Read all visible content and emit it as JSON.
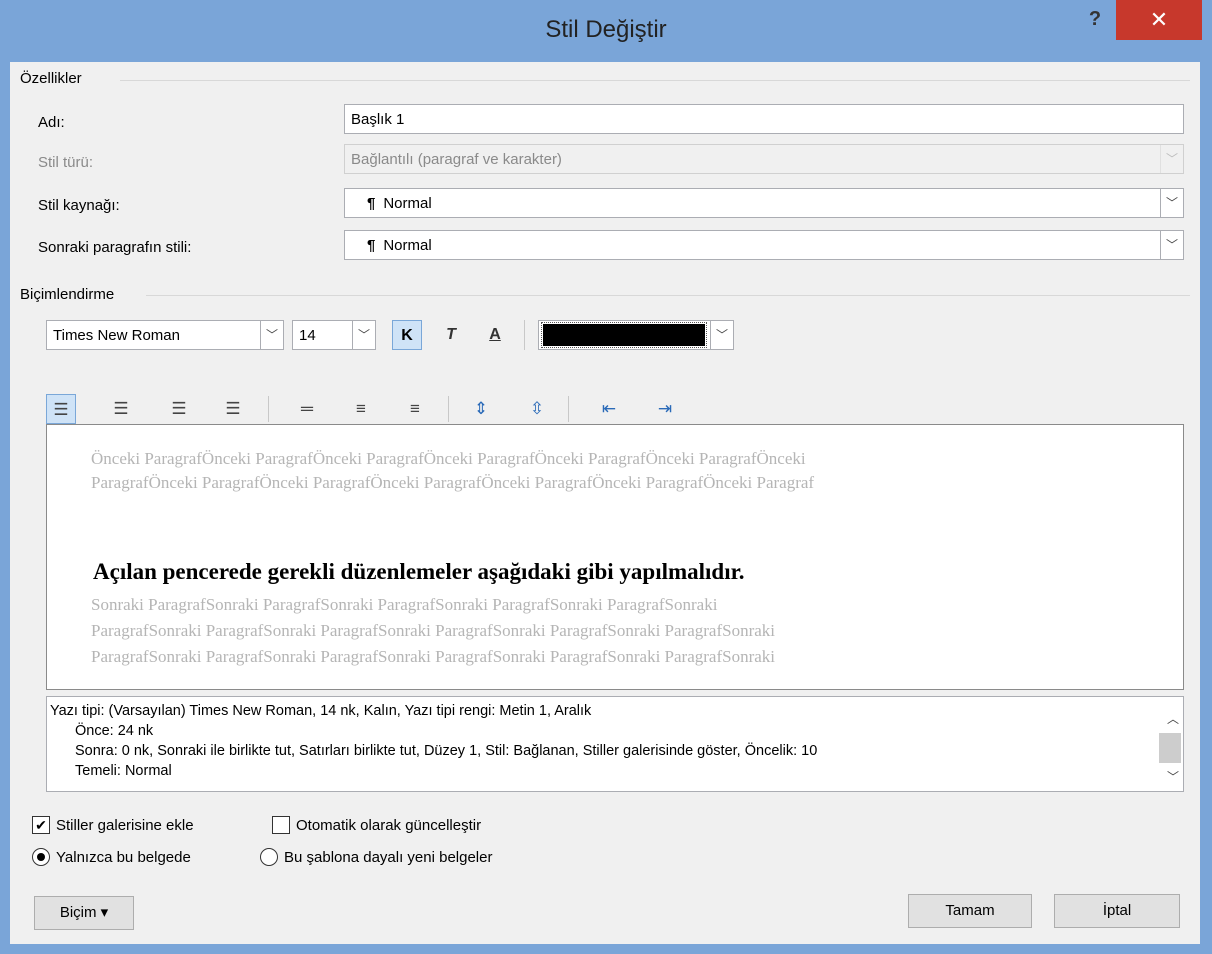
{
  "window": {
    "title": "Stil Değiştir",
    "help": "?",
    "close": "✕"
  },
  "properties": {
    "group_label": "Özellikler",
    "name": {
      "label": "Adı:",
      "value": "Başlık 1"
    },
    "style_type": {
      "label": "Stil türü:",
      "value": "Bağlantılı (paragraf ve karakter)"
    },
    "style_base": {
      "label": "Stil kaynağı:",
      "value": "Normal"
    },
    "next_style": {
      "label": "Sonraki paragrafın stili:",
      "value": "Normal"
    }
  },
  "formatting": {
    "group_label": "Biçimlendirme",
    "font": "Times New Roman",
    "size": "14",
    "bold": "K",
    "italic": "T",
    "underline": "A",
    "font_color": "#000000"
  },
  "preview": {
    "previous_line1": "Önceki ParagrafÖnceki ParagrafÖnceki ParagrafÖnceki ParagrafÖnceki ParagrafÖnceki ParagrafÖnceki",
    "previous_line2": "ParagrafÖnceki ParagrafÖnceki ParagrafÖnceki ParagrafÖnceki ParagrafÖnceki ParagrafÖnceki Paragraf",
    "heading": "Açılan pencerede gerekli düzenlemeler aşağıdaki gibi yapılmalıdır.",
    "next_line1": "Sonraki ParagrafSonraki ParagrafSonraki ParagrafSonraki ParagrafSonraki ParagrafSonraki",
    "next_line2": "ParagrafSonraki ParagrafSonraki ParagrafSonraki ParagrafSonraki ParagrafSonraki ParagrafSonraki",
    "next_line3": "ParagrafSonraki ParagrafSonraki ParagrafSonraki ParagrafSonraki ParagrafSonraki ParagrafSonraki"
  },
  "description": {
    "line1": "Yazı tipi: (Varsayılan) Times New Roman, 14 nk, Kalın, Yazı tipi rengi: Metin 1, Aralık",
    "line2": "Önce:  24 nk",
    "line3": "Sonra:  0 nk, Sonraki ile birlikte tut, Satırları birlikte tut, Düzey 1, Stil: Bağlanan, Stiller galerisinde göster, Öncelik: 10",
    "line4": "Temeli: Normal"
  },
  "options": {
    "add_to_gallery": {
      "label": "Stiller galerisine ekle",
      "checked": true
    },
    "auto_update": {
      "label": "Otomatik olarak güncelleştir",
      "checked": false
    },
    "only_this_doc": {
      "label": "Yalnızca bu belgede",
      "selected": true
    },
    "new_docs": {
      "label": "Bu şablona dayalı yeni belgeler",
      "selected": false
    }
  },
  "buttons": {
    "format": "Biçim ▾",
    "ok": "Tamam",
    "cancel": "İptal"
  }
}
